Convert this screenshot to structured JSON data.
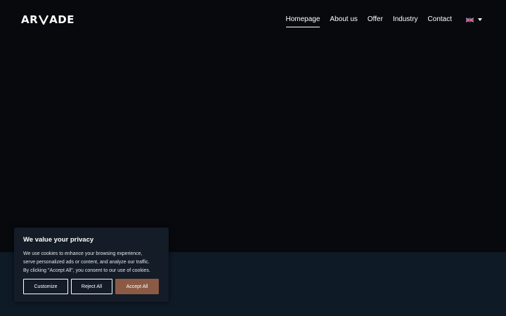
{
  "header": {
    "logo_text_left": "AR",
    "logo_text_right": "ADE",
    "nav": [
      {
        "label": "Homepage",
        "active": true
      },
      {
        "label": "About us",
        "active": false
      },
      {
        "label": "Offer",
        "active": false
      },
      {
        "label": "Industry",
        "active": false
      },
      {
        "label": "Contact",
        "active": false
      }
    ],
    "language_icon": "uk-flag-icon"
  },
  "cookie": {
    "title": "We value your privacy",
    "lines": [
      "We use cookies to enhance your browsing experience,",
      "serve personalized ads or content, and analyze our traffic.",
      "By clicking \"Accept All\", you consent to our use of cookies."
    ],
    "buttons": {
      "customize": "Customize",
      "reject": "Reject All",
      "accept": "Accept All"
    }
  },
  "colors": {
    "background": "#07090d",
    "lower_band": "#0e1a26",
    "panel": "#131c27",
    "accent": "#8b5a45"
  }
}
